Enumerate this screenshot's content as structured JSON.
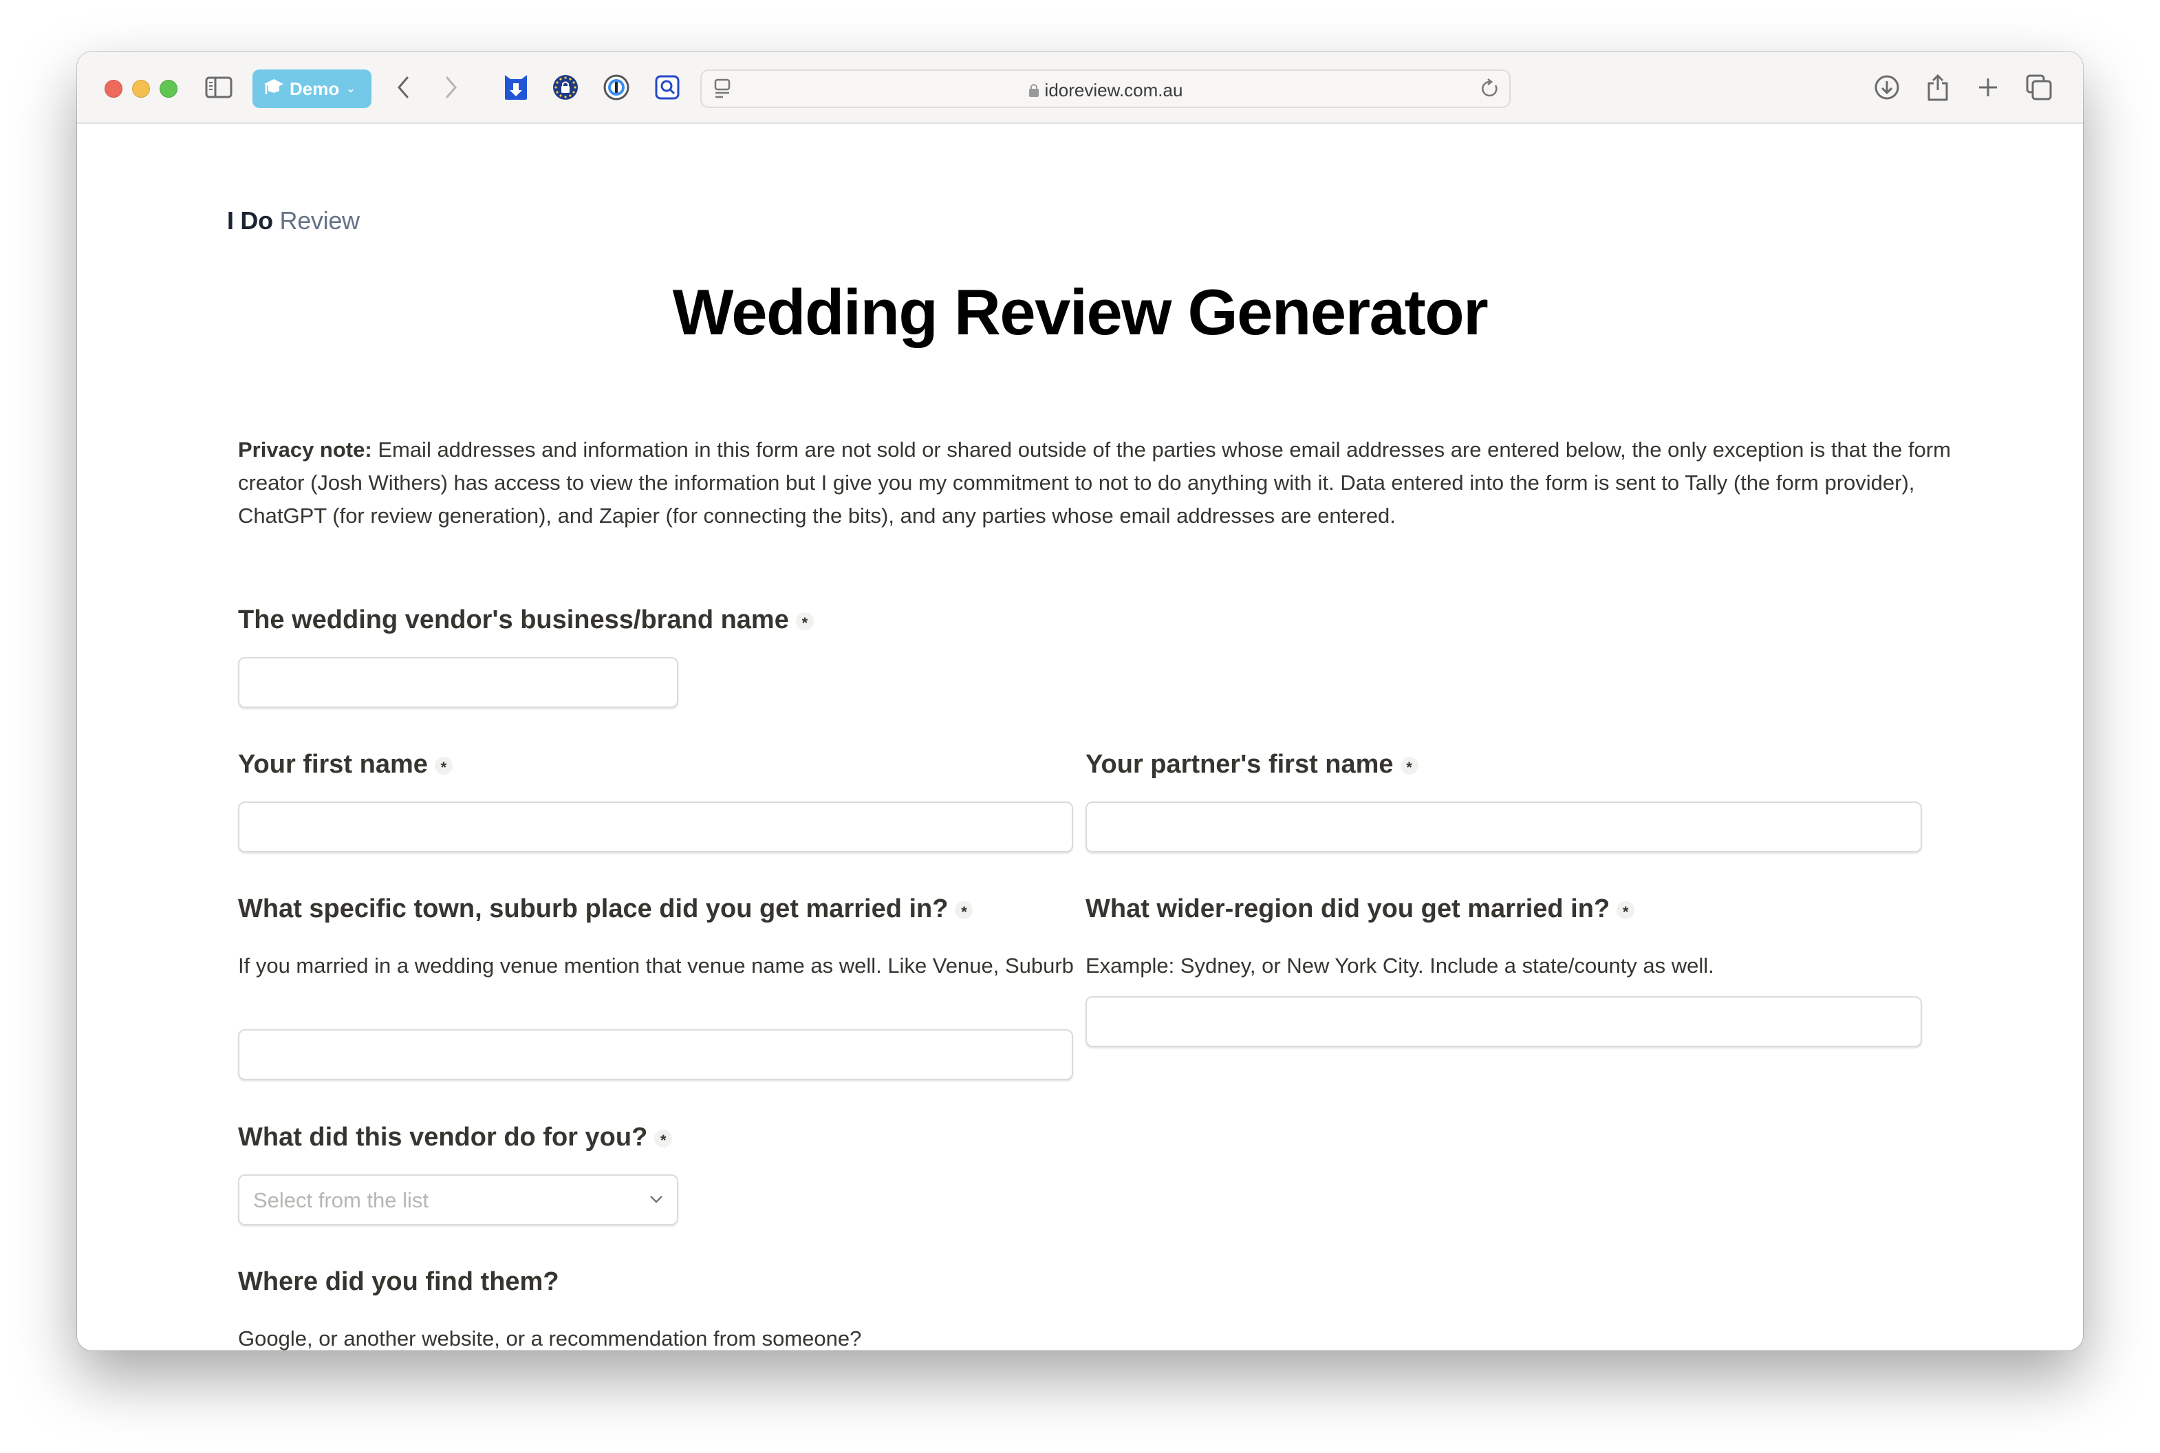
{
  "browser": {
    "profile_label": "Demo",
    "url": "idoreview.com.au",
    "toolbar_icons": [
      "sidebar-icon",
      "back-icon",
      "forward-icon",
      "bookmark-download-extension-icon",
      "eu-lock-extension-icon",
      "password-manager-extension-icon",
      "search-extension-icon",
      "page-menu-icon",
      "reload-icon",
      "download-icon",
      "share-icon",
      "new-tab-icon",
      "tab-overview-icon"
    ]
  },
  "site": {
    "logo_bold": "I Do",
    "logo_light": "Review"
  },
  "page": {
    "title": "Wedding Review Generator",
    "privacy_label": "Privacy note:",
    "privacy_text": " Email addresses and information in this form are not sold or shared outside of the parties whose email addresses are entered below, the only exception is that the form creator (Josh Withers) has access to view the information but I give you my commitment to not to do anything with it. Data entered into the form is sent to Tally (the form provider), ChatGPT (for review generation), and Zapier (for connecting the bits), and any parties whose email addresses are entered."
  },
  "form": {
    "required_mark": "*",
    "vendor_name": {
      "label": "The wedding vendor's business/brand name",
      "value": ""
    },
    "first_name": {
      "label": "Your first name",
      "value": ""
    },
    "partner_name": {
      "label": "Your partner's first name",
      "value": ""
    },
    "town": {
      "label": "What specific town, suburb place did you get married in?",
      "help": "If you married in a wedding venue mention that venue name as well. Like Venue, Suburb",
      "value": ""
    },
    "region": {
      "label": "What wider-region did you get married in?",
      "help": "Example: Sydney, or New York City. Include a state/county as well.",
      "value": ""
    },
    "vendor_service": {
      "label": "What did this vendor do for you?",
      "placeholder": "Select from the list"
    },
    "found": {
      "label": "Where did you find them?",
      "help": "Google, or another website, or a recommendation from someone?",
      "value": ""
    }
  }
}
